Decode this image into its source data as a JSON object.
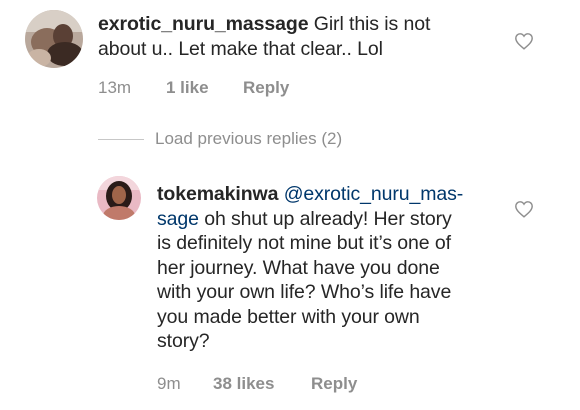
{
  "comments": [
    {
      "username": "exrotic_nuru_massage",
      "text_line1": " Girl this is not",
      "text_line2": "about u.. Let make that clear.. Lol",
      "time": "13m",
      "likes": "1 like",
      "reply": "Reply"
    },
    {
      "username": "tokemakinwa",
      "mention_part1": " @exrotic_nuru_mas-",
      "mention_part2": "sage",
      "line2_rest": " oh shut up already! Her story",
      "lines": [
        "is definitely not mine but it’s one of",
        "her journey. What have you done",
        "with your own life? Who’s life have",
        "you made better with your own",
        "story?"
      ],
      "time": "9m",
      "likes": "38 likes",
      "reply": "Reply"
    }
  ],
  "load_previous": "Load previous replies (2)",
  "icons": {
    "like": "heart-outline-icon"
  },
  "colors": {
    "mention": "#00376b",
    "meta": "#8e8e8e",
    "text": "#262626"
  }
}
